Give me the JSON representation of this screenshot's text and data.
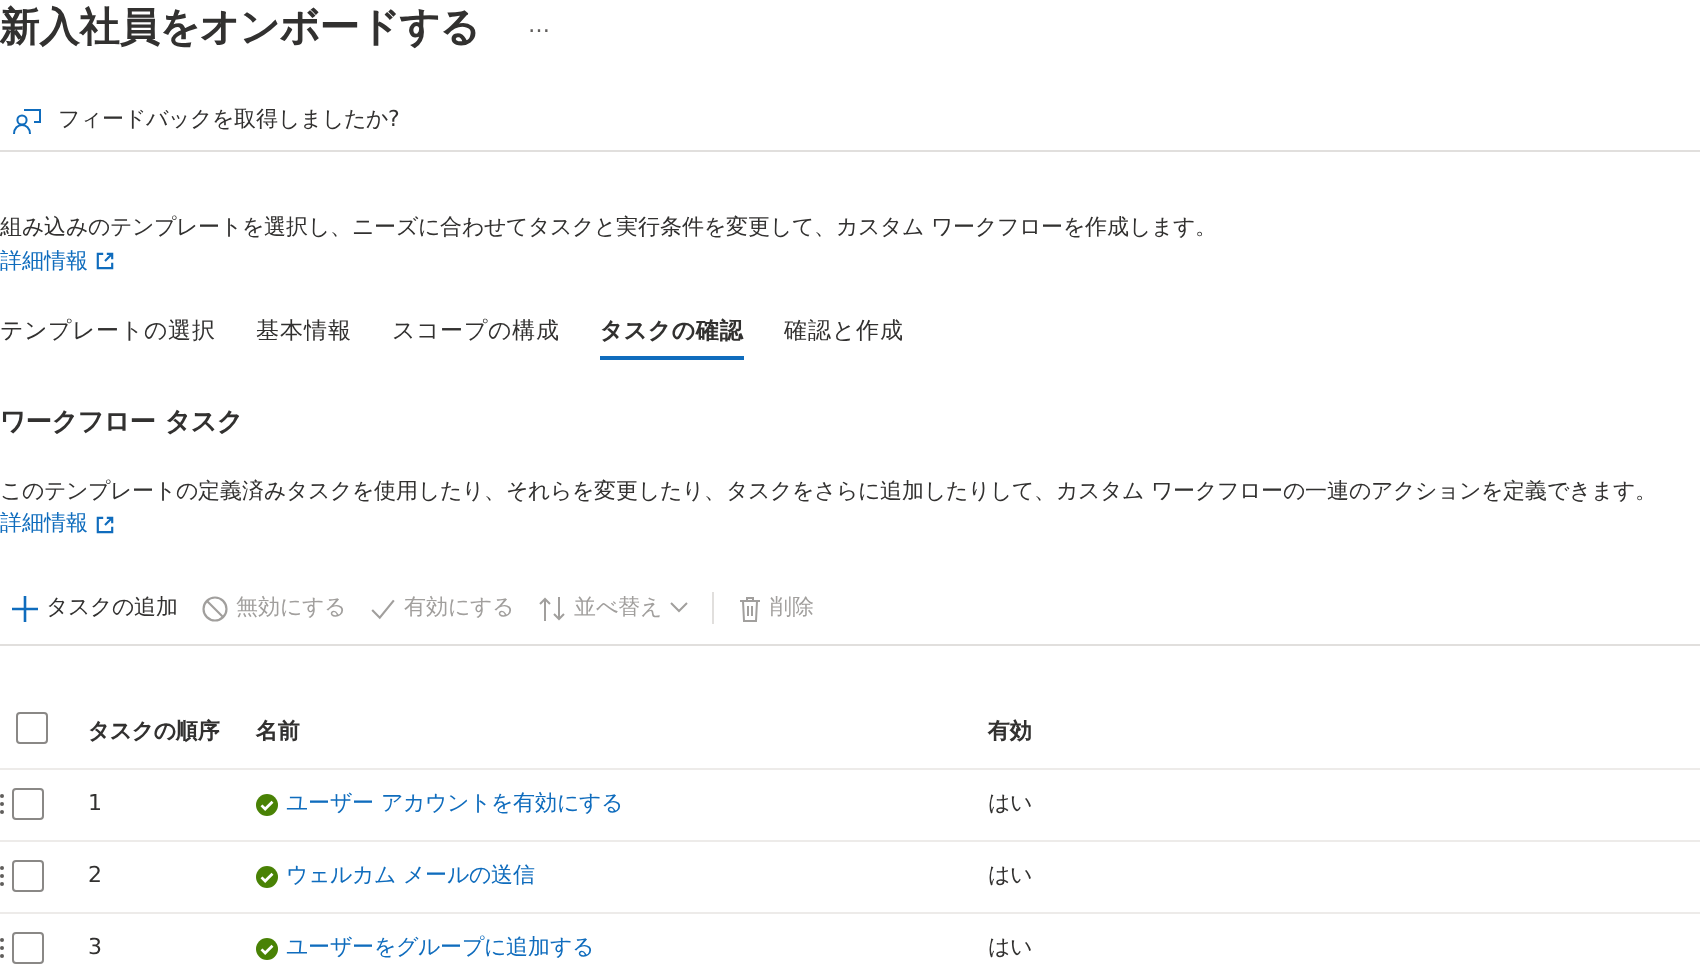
{
  "page": {
    "title": "新入社員をオンボードする",
    "more": "…"
  },
  "feedback": {
    "label": "フィードバックを取得しましたか?"
  },
  "intro": {
    "text": "組み込みのテンプレートを選択し、ニーズに合わせてタスクと実行条件を変更して、カスタム ワークフローを作成します。",
    "link": "詳細情報"
  },
  "tabs": [
    {
      "label": "テンプレートの選択",
      "selected": false
    },
    {
      "label": "基本情報",
      "selected": false
    },
    {
      "label": "スコープの構成",
      "selected": false
    },
    {
      "label": "タスクの確認",
      "selected": true
    },
    {
      "label": "確認と作成",
      "selected": false
    }
  ],
  "section": {
    "heading": "ワークフロー タスク",
    "text": "このテンプレートの定義済みタスクを使用したり、それらを変更したり、タスクをさらに追加したりして、カスタム ワークフローの一連のアクションを定義できます。",
    "link": "詳細情報"
  },
  "toolbar": [
    {
      "kind": "add",
      "label": "タスクの追加",
      "disabled": false
    },
    {
      "kind": "disable",
      "label": "無効にする",
      "disabled": true
    },
    {
      "kind": "enable",
      "label": "有効にする",
      "disabled": true
    },
    {
      "kind": "sort",
      "label": "並べ替え",
      "disabled": true
    },
    {
      "kind": "delete",
      "label": "削除",
      "disabled": true
    }
  ],
  "table": {
    "columns": [
      "タスクの順序",
      "名前",
      "有効"
    ],
    "header_checked": false,
    "rows": [
      {
        "order": "1",
        "name": "ユーザー アカウントを有効にする",
        "enabled": "はい",
        "checked": false
      },
      {
        "order": "2",
        "name": "ウェルカム メールの送信",
        "enabled": "はい",
        "checked": false
      },
      {
        "order": "3",
        "name": "ユーザーをグループに追加する",
        "enabled": "はい",
        "checked": false
      }
    ]
  }
}
